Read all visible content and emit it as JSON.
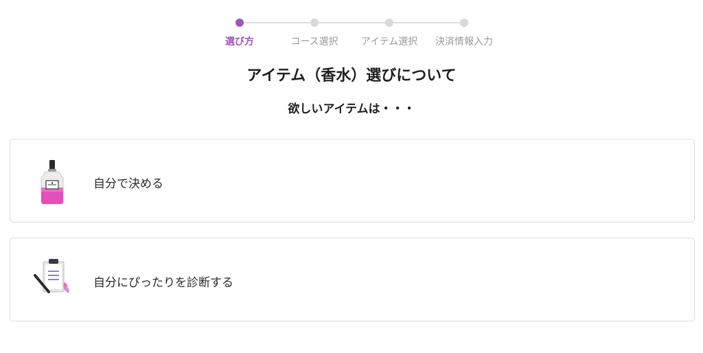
{
  "stepper": {
    "steps": [
      {
        "label": "選び方",
        "active": true
      },
      {
        "label": "コース選択",
        "active": false
      },
      {
        "label": "アイテム選択",
        "active": false
      },
      {
        "label": "決済情報入力",
        "active": false
      }
    ],
    "accent_color": "#9b59b6",
    "inactive_color": "#d9d9d9"
  },
  "main": {
    "title": "アイテム（香水）選びについて",
    "subtitle": "欲しいアイテムは・・・",
    "options": [
      {
        "label": "自分で決める",
        "icon": "perfume-bottle-icon"
      },
      {
        "label": "自分にぴったりを診断する",
        "icon": "clipboard-pen-icon"
      }
    ]
  }
}
